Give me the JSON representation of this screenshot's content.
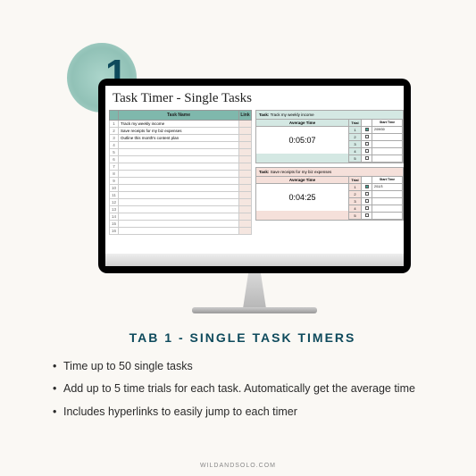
{
  "badge": {
    "number": "1."
  },
  "sheet": {
    "title": "Task Timer - Single Tasks",
    "columns": {
      "name": "Task Name",
      "link": "Link"
    },
    "tasks": [
      "Track my weekly income",
      "Save receipts for my biz expenses",
      "Outline this month's content plan"
    ]
  },
  "timers": [
    {
      "task_label": "Task:",
      "task_name": "Track my weekly income",
      "avg_label": "Average Time",
      "avg_time": "0:05:07",
      "trial_label": "Trial",
      "start_label": "Start Time",
      "trials": [
        {
          "n": "1",
          "checked": true,
          "time": "2/09/30"
        },
        {
          "n": "2",
          "checked": false,
          "time": ""
        },
        {
          "n": "3",
          "checked": false,
          "time": ""
        },
        {
          "n": "4",
          "checked": false,
          "time": ""
        },
        {
          "n": "5",
          "checked": false,
          "time": ""
        }
      ]
    },
    {
      "task_label": "Task:",
      "task_name": "Save receipts for my biz expenses",
      "avg_label": "Average Time",
      "avg_time": "0:04:25",
      "trial_label": "Trial",
      "start_label": "Start Time",
      "trials": [
        {
          "n": "1",
          "checked": true,
          "time": "2/11/3"
        },
        {
          "n": "2",
          "checked": false,
          "time": ""
        },
        {
          "n": "3",
          "checked": false,
          "time": ""
        },
        {
          "n": "4",
          "checked": false,
          "time": ""
        },
        {
          "n": "5",
          "checked": false,
          "time": ""
        }
      ]
    }
  ],
  "description": {
    "title": "TAB 1 - SINGLE TASK TIMERS",
    "bullets": [
      "Time up to 50 single tasks",
      "Add up to 5 time trials for each task. Automatically get the average time",
      "Includes hyperlinks to easily jump to each timer"
    ]
  },
  "footer": "WILDANDSOLO.COM"
}
